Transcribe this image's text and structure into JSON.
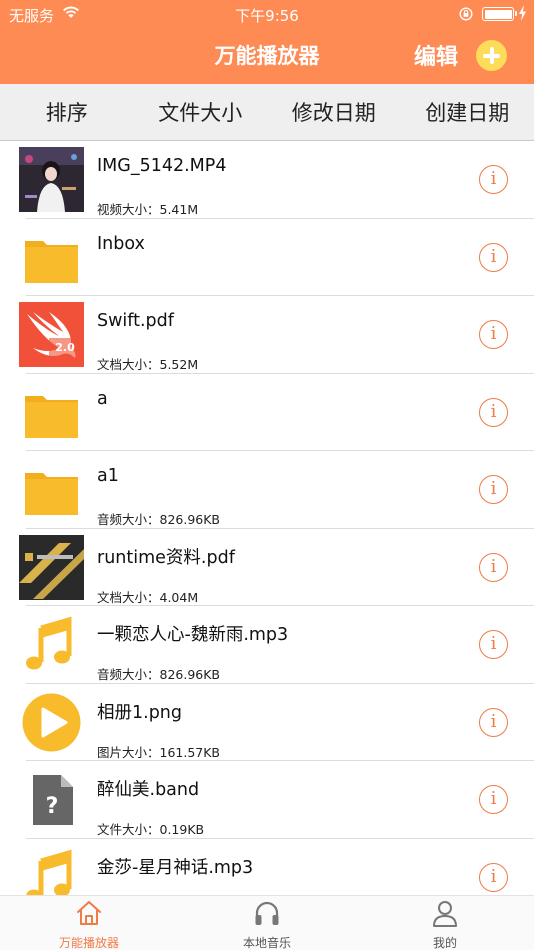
{
  "status_bar": {
    "carrier": "无服务",
    "time": "下午9:56"
  },
  "nav": {
    "title": "万能播放器",
    "edit_label": "编辑"
  },
  "sort_options": [
    "排序",
    "文件大小",
    "修改日期",
    "创建日期"
  ],
  "files": [
    {
      "name": "IMG_5142.MP4",
      "size": "视频大小：5.41M",
      "thumb": "video-thumbnail"
    },
    {
      "name": "Inbox",
      "size": "",
      "thumb": "folder-icon"
    },
    {
      "name": "Swift.pdf",
      "size": "文档大小：5.52M",
      "thumb": "swift-book-cover"
    },
    {
      "name": "a",
      "size": "",
      "thumb": "folder-icon"
    },
    {
      "name": "a1",
      "size": "音频大小：826.96KB",
      "thumb": "folder-icon"
    },
    {
      "name": "runtime资料.pdf",
      "size": "文档大小：4.04M",
      "thumb": "pdf-cover"
    },
    {
      "name": "一颗恋人心-魏新雨.mp3",
      "size": "音频大小：826.96KB",
      "thumb": "music-note-icon"
    },
    {
      "name": "相册1.png",
      "size": "图片大小：161.57KB",
      "thumb": "play-icon"
    },
    {
      "name": "醉仙美.band",
      "size": "文件大小：0.19KB",
      "thumb": "unknown-file-icon"
    },
    {
      "name": "金莎-星月神话.mp3",
      "size": "",
      "thumb": "music-note-icon"
    }
  ],
  "tabs": [
    {
      "label": "万能播放器",
      "icon": "home-icon",
      "active": true
    },
    {
      "label": "本地音乐",
      "icon": "headphones-icon",
      "active": false
    },
    {
      "label": "我的",
      "icon": "person-icon",
      "active": false
    }
  ],
  "colors": {
    "brand": "#fe8b53",
    "accent": "#f07b46",
    "add_button": "#fddc5a",
    "folder": "#f7bb2c"
  }
}
